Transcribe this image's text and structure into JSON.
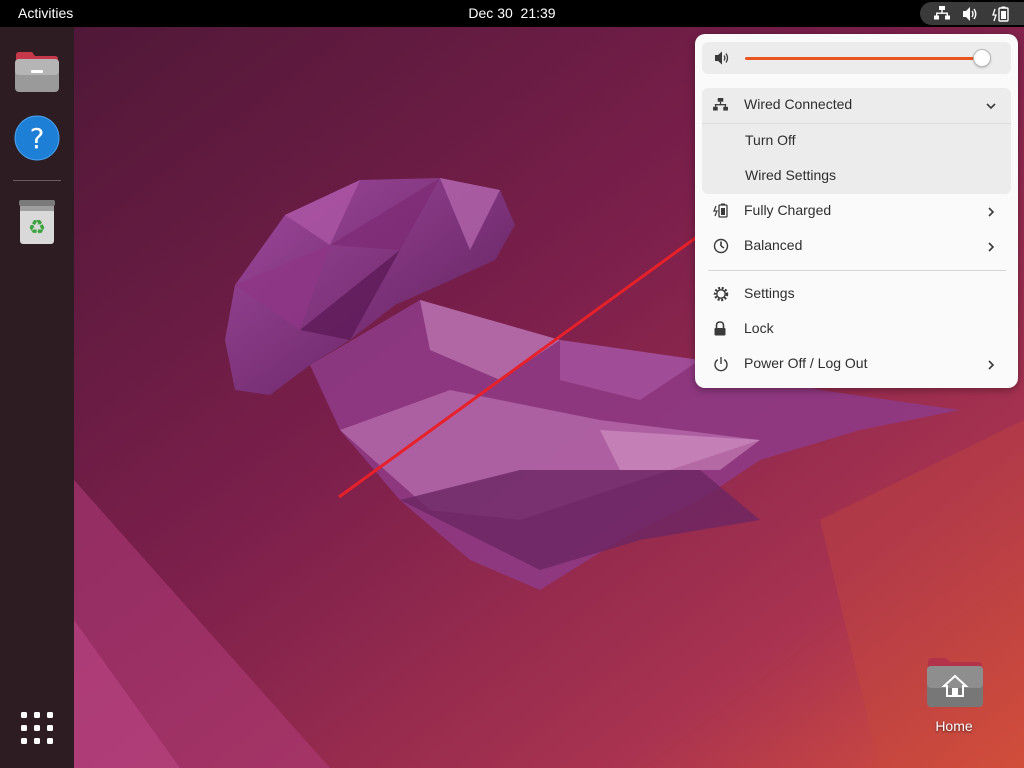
{
  "topbar": {
    "activities_label": "Activities",
    "date": "Dec 30",
    "time": "21:39",
    "tray_icons": [
      "network-wired-icon",
      "volume-icon",
      "battery-icon"
    ]
  },
  "dock": {
    "items": [
      {
        "name": "Files",
        "icon": "file-manager-icon"
      },
      {
        "name": "Help",
        "icon": "help-icon"
      },
      {
        "name": "Trash",
        "icon": "trash-icon"
      }
    ],
    "apps_grid_icon": "show-apps-icon"
  },
  "system_menu": {
    "volume": {
      "level": 0.94,
      "icon": "speaker-icon"
    },
    "network": {
      "title": "Wired Connected",
      "icon": "network-wired-icon",
      "expanded": true,
      "items": [
        {
          "label": "Turn Off"
        },
        {
          "label": "Wired Settings"
        }
      ]
    },
    "power": {
      "label": "Fully Charged",
      "icon": "battery-icon"
    },
    "power_mode": {
      "label": "Balanced",
      "icon": "power-mode-icon"
    },
    "settings_label": "Settings",
    "lock_label": "Lock",
    "power_off_label": "Power Off / Log Out"
  },
  "desktop": {
    "home_label": "Home"
  },
  "colors": {
    "accent": "#e95420",
    "annotation_arrow": "#e8202a"
  }
}
